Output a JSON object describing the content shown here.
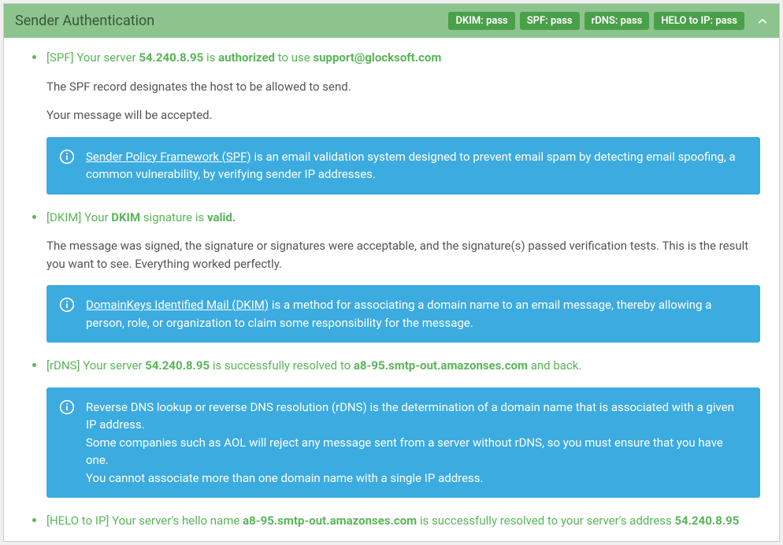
{
  "header": {
    "title": "Sender Authentication",
    "badges": [
      "DKIM: pass",
      "SPF: pass",
      "rDNS: pass",
      "HELO to IP: pass"
    ]
  },
  "items": [
    {
      "title_parts": {
        "p1": "[SPF] Your server ",
        "b1": "54.240.8.95",
        "p2": " is ",
        "b2": "authorized",
        "p3": " to use ",
        "b3": "support@glocksoft.com"
      },
      "paras": [
        "The SPF record designates the host to be allowed to send.",
        "Your message will be accepted."
      ],
      "info": {
        "link": "Sender Policy Framework (SPF)",
        "rest": " is an email validation system designed to prevent email spam by detecting email spoofing, a common vulnerability, by verifying sender IP addresses."
      }
    },
    {
      "title_parts": {
        "p1": "[DKIM] Your ",
        "b1": "DKIM",
        "p2": " signature is ",
        "b2": "valid.",
        "p3": "",
        "b3": ""
      },
      "paras": [
        "The message was signed, the signature or signatures were acceptable, and the signature(s) passed verification tests. This is the result you want to see. Everything worked perfectly."
      ],
      "info": {
        "link": "DomainKeys Identified Mail (DKIM)",
        "rest": " is a method for associating a domain name to an email message, thereby allowing a person, role, or organization to claim some responsibility for the message."
      }
    },
    {
      "title_parts": {
        "p1": "[rDNS] Your server ",
        "b1": "54.240.8.95",
        "p2": " is successfully resolved to ",
        "b2": "a8-95.smtp-out.amazonses.com",
        "p3": " and back.",
        "b3": ""
      },
      "paras": [],
      "info": {
        "link": "",
        "rest": "Reverse DNS lookup or reverse DNS resolution (rDNS) is the determination of a domain name that is associated with a given IP address.\nSome companies such as AOL will reject any message sent from a server without rDNS, so you must ensure that you have one.\nYou cannot associate more than one domain name with a single IP address."
      }
    },
    {
      "title_parts": {
        "p1": "[HELO to IP] Your server's hello name ",
        "b1": "a8-95.smtp-out.amazonses.com",
        "p2": " is successfully resolved to your server's address ",
        "b2": "54.240.8.95",
        "p3": "",
        "b3": ""
      },
      "paras": [],
      "info": null
    }
  ]
}
